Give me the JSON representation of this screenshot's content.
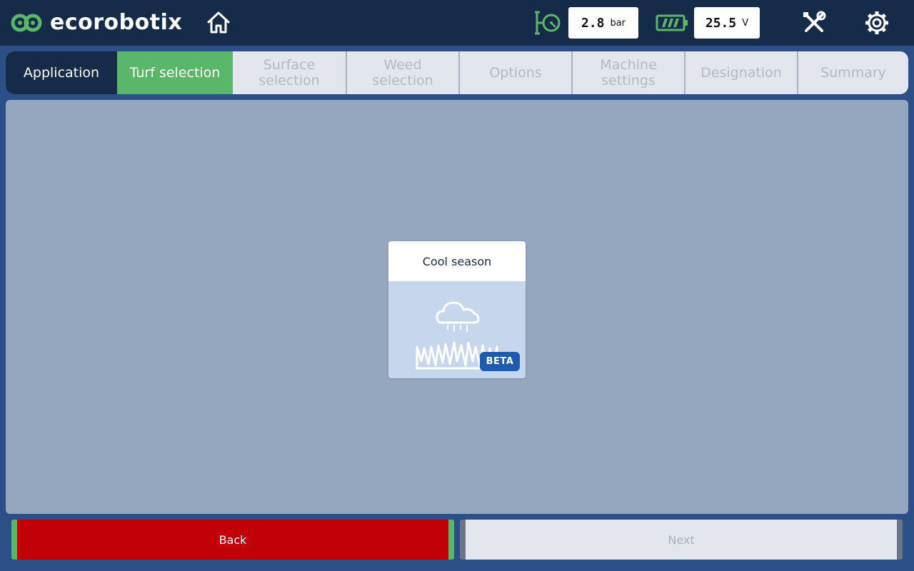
{
  "header": {
    "brand": "ecorobotix",
    "logo_icon": "ecorobotix-logo",
    "home_icon": "home-icon",
    "pressure": {
      "icon": "pressure-gauge-icon",
      "value": "2.8",
      "unit": "bar"
    },
    "battery": {
      "icon": "battery-icon",
      "value": "25.5",
      "unit": "V"
    },
    "tools_icon": "tools-icon",
    "settings_icon": "gear-icon"
  },
  "steps": [
    {
      "label": "Application",
      "state": "done"
    },
    {
      "label": "Turf selection",
      "state": "active"
    },
    {
      "label": "Surface selection",
      "state": "pending"
    },
    {
      "label": "Weed selection",
      "state": "pending"
    },
    {
      "label": "Options",
      "state": "pending"
    },
    {
      "label": "Machine settings",
      "state": "pending"
    },
    {
      "label": "Designation",
      "state": "pending"
    },
    {
      "label": "Summary",
      "state": "pending"
    }
  ],
  "card": {
    "title": "Cool season",
    "icon": "cloud-rain-grass-icon",
    "badge": "BETA"
  },
  "footer": {
    "back_label": "Back",
    "next_label": "Next"
  },
  "colors": {
    "header_bg": "#162a4a",
    "accent_green": "#5ab76a",
    "back_red": "#c10007",
    "panel_bg": "#95a6bf",
    "beta_blue": "#1f5cb0"
  }
}
